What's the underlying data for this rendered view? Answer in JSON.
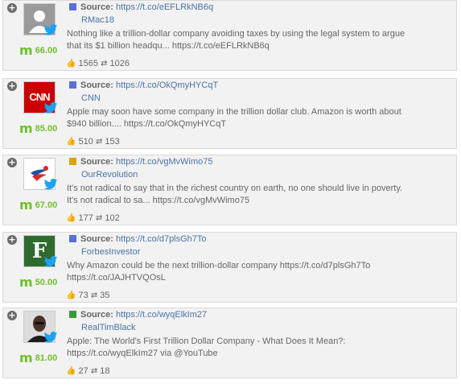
{
  "posts": [
    {
      "source_label": "Source:",
      "source_link": "https://t.co/eEFLRkNB6q",
      "source_color": "#5a6fd6",
      "author": "RMac18",
      "avatar": "default-user-avatar",
      "score": "66.00",
      "text": "Nothing like a trillion-dollar company avoiding taxes by using the legal system to argue that its $1 billion headqu... https://t.co/eEFLRkNB6q",
      "likes": "1565",
      "retweets": "1026"
    },
    {
      "source_label": "Source:",
      "source_link": "https://t.co/OkQmyHYCqT",
      "source_color": "#5a6fd6",
      "author": "CNN",
      "avatar": "cnn-logo",
      "avatar_text": "CNN",
      "score": "85.00",
      "text": "Apple may soon have some company in the trillion dollar club. Amazon is worth about $940 billion.... https://t.co/OkQmyHYCqT",
      "likes": "510",
      "retweets": "153"
    },
    {
      "source_label": "Source:",
      "source_link": "https://t.co/vgMvWimo75",
      "source_color": "#d9a300",
      "author": "OurRevolution",
      "avatar": "our-revolution-logo",
      "score": "67.00",
      "text": "It's not radical to say that in the richest country on earth, no one should live in poverty. It's not radical to sa... https://t.co/vgMvWimo75",
      "likes": "177",
      "retweets": "102"
    },
    {
      "source_label": "Source:",
      "source_link": "https://t.co/d7plsGh7To",
      "source_color": "#5a6fd6",
      "author": "ForbesInvestor",
      "avatar": "forbes-logo",
      "avatar_text": "F",
      "score": "50.00",
      "text": "Why Amazon could be the next trillion-dollar company https://t.co/d7plsGh7To https://t.co/JAJHTVQOsL",
      "likes": "73",
      "retweets": "35"
    },
    {
      "source_label": "Source:",
      "source_link": "https://t.co/wyqElkIm27",
      "source_color": "#3a9a3a",
      "author": "RealTimBlack",
      "avatar": "person-photo",
      "score": "81.00",
      "text": "Apple: The World's First Trillion Dollar Company - What Does It Mean?: https://t.co/wyqElkIm27 via @YouTube",
      "likes": "27",
      "retweets": "18"
    }
  ],
  "colors": {
    "score_green": "#6ec02a",
    "link_blue": "#4a73a6",
    "twitter_blue": "#1da1f2"
  }
}
